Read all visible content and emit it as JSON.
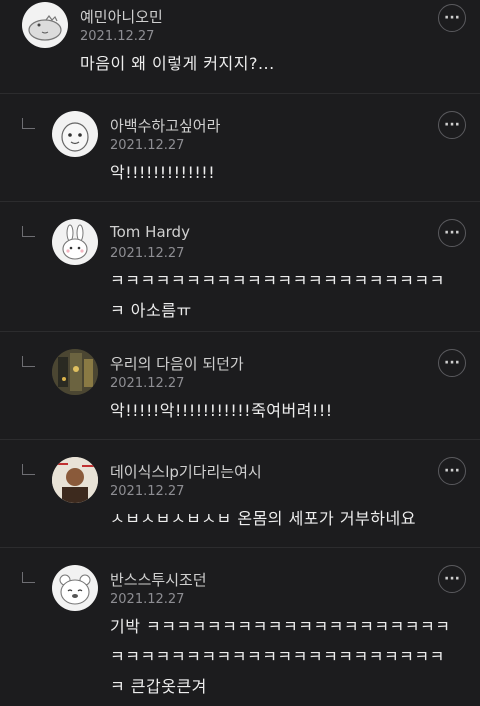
{
  "comments": [
    {
      "author": "예민아니오민",
      "date": "2021.12.27",
      "text": "마음이 왜 이렇게 커지지?...",
      "avatar": "dinosaur-avatar"
    },
    {
      "author": "아백수하고싶어라",
      "date": "2021.12.27",
      "text": "악!!!!!!!!!!!!!",
      "avatar": "character-avatar"
    },
    {
      "author": "Tom Hardy",
      "date": "2021.12.27",
      "text": "ㅋㅋㅋㅋㅋㅋㅋㅋㅋㅋㅋㅋㅋㅋㅋㅋㅋㅋㅋㅋㅋㅋㅋ 아소름ㅠ",
      "avatar": "rabbit-avatar"
    },
    {
      "author": "우리의 다음이 되던가",
      "date": "2021.12.27",
      "text": "악!!!!!악!!!!!!!!!!!죽여버려!!!",
      "avatar": "photo-avatar"
    },
    {
      "author": "데이식스lp기다리는여시",
      "date": "2021.12.27",
      "text": "ㅅㅂㅅㅂㅅㅂㅅㅂ 온몸의 세포가 거부하네요",
      "avatar": "person-photo-avatar"
    },
    {
      "author": "반스스투시조던",
      "date": "2021.12.27",
      "text": "기박 ㅋㅋㅋㅋㅋㅋㅋㅋㅋㅋㅋㅋㅋㅋㅋㅋㅋㅋㅋㅋㅋㅋㅋㅋㅋㅋㅋㅋㅋㅋㅋㅋㅋㅋㅋㅋㅋㅋㅋㅋㅋㅋㅋ 큰갑옷큰겨",
      "avatar": "bear-avatar"
    }
  ],
  "more_label": "···"
}
